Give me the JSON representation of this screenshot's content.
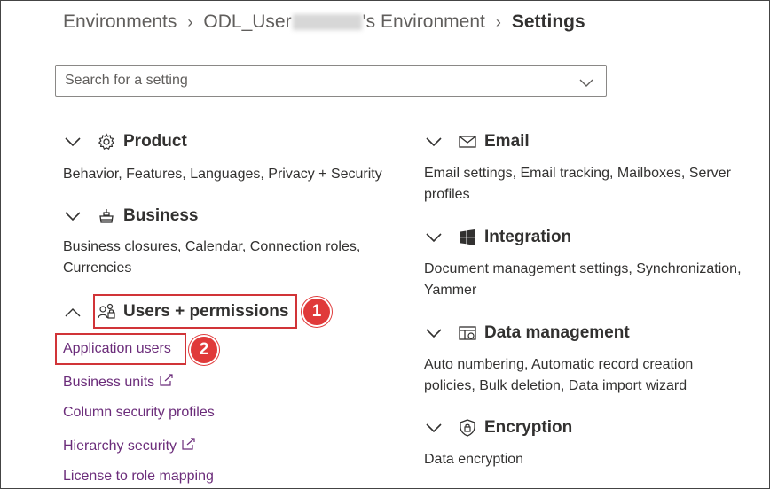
{
  "breadcrumb": {
    "root": "Environments",
    "env_prefix": "ODL_User",
    "env_suffix": "'s Environment",
    "current": "Settings"
  },
  "search": {
    "placeholder": "Search for a setting"
  },
  "left_groups": [
    {
      "title": "Product",
      "icon": "gear-icon",
      "expanded": false,
      "description": "Behavior, Features, Languages, Privacy + Security"
    },
    {
      "title": "Business",
      "icon": "business-icon",
      "expanded": false,
      "description_lines": [
        "Business closures, Calendar, Connection roles,",
        "Currencies"
      ]
    },
    {
      "title": "Users + permissions",
      "icon": "users-permissions-icon",
      "expanded": true,
      "links": [
        {
          "label": "Application users",
          "external": false
        },
        {
          "label": "Business units",
          "external": true
        },
        {
          "label": "Column security profiles",
          "external": false
        },
        {
          "label": "Hierarchy security",
          "external": true
        },
        {
          "label": "License to role mapping",
          "external": false
        }
      ]
    }
  ],
  "right_groups": [
    {
      "title": "Email",
      "icon": "mail-icon",
      "description_lines": [
        "Email settings, Email tracking, Mailboxes, Server",
        "profiles"
      ]
    },
    {
      "title": "Integration",
      "icon": "windows-icon",
      "description_lines": [
        "Document management settings, Synchronization,",
        "Yammer"
      ]
    },
    {
      "title": "Data management",
      "icon": "data-management-icon",
      "description_lines": [
        "Auto numbering, Automatic record creation",
        "policies, Bulk deletion, Data import wizard"
      ]
    },
    {
      "title": "Encryption",
      "icon": "encryption-icon",
      "description_lines": [
        "Data encryption"
      ]
    }
  ],
  "callouts": {
    "step1": "1",
    "step2": "2"
  },
  "colors": {
    "link": "#6b2c7a",
    "callout": "#d13438",
    "badge": "#e03a3a"
  }
}
